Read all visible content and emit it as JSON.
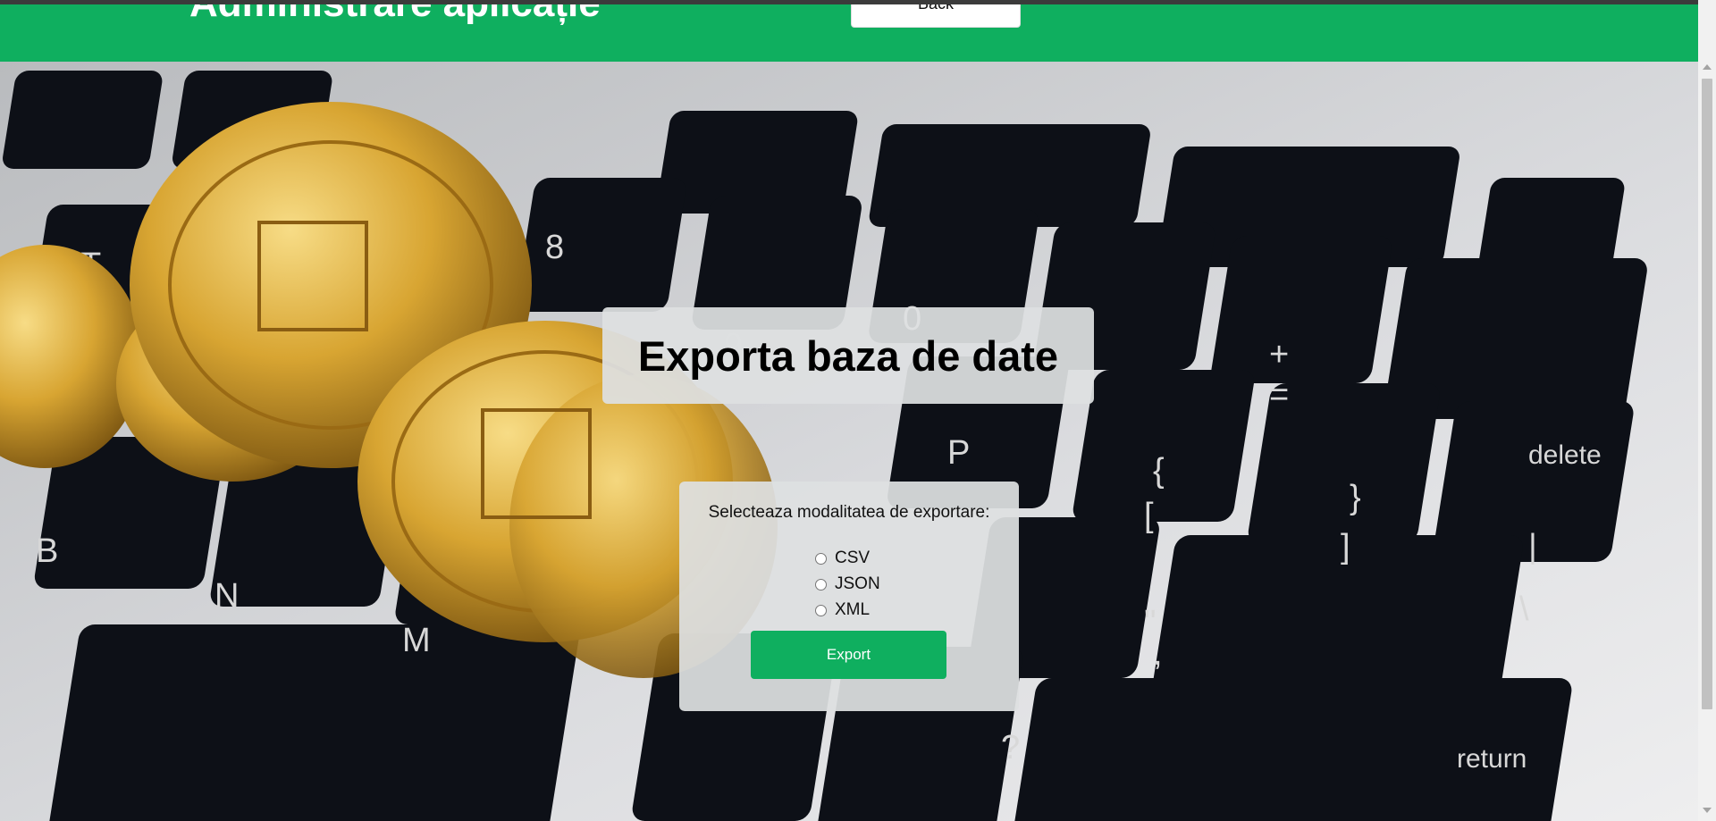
{
  "header": {
    "title": "Administrare aplicație",
    "back_label": "Back"
  },
  "main": {
    "title": "Exporta baza de date",
    "form": {
      "label": "Selecteaza modalitatea de exportare:",
      "options": [
        {
          "label": "CSV",
          "selected": false
        },
        {
          "label": "JSON",
          "selected": false
        },
        {
          "label": "XML",
          "selected": false
        }
      ],
      "export_label": "Export"
    }
  },
  "colors": {
    "brand_green": "#0faf5f",
    "panel": "#dee0e1",
    "key_dark": "#0d1017",
    "keyboard_silver": "#d9dadc",
    "coin_gold": "#d8a532"
  },
  "background_image": "laptop-keyboard-with-gold-bitcoins"
}
